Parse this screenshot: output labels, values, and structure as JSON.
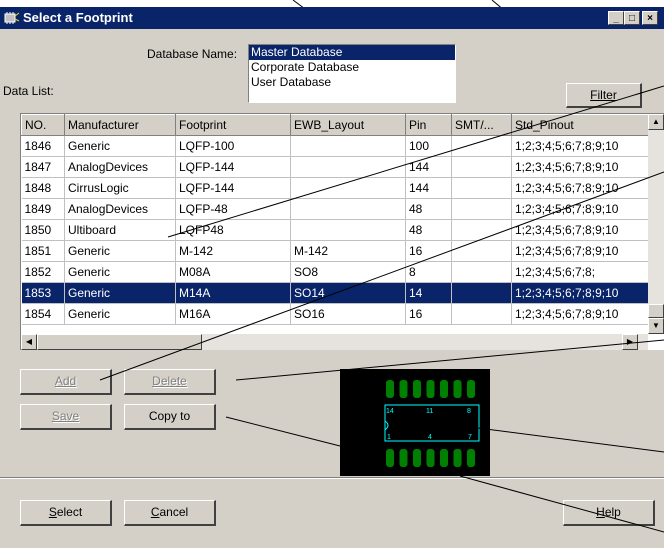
{
  "window": {
    "title": "Select a Footprint",
    "minimize_glyph": "_",
    "maximize_glyph": "□",
    "close_glyph": "×"
  },
  "database": {
    "label": "Database Name:",
    "options": [
      "Master Database",
      "Corporate Database",
      "User Database"
    ],
    "selected": "Master Database"
  },
  "data_list_label": "Data List:",
  "filter_button": "Filter",
  "table": {
    "columns": [
      "NO.",
      "Manufacturer",
      "Footprint",
      "EWB_Layout",
      "Pin",
      "SMT/...",
      "Std_Pinout"
    ],
    "rows": [
      [
        "1846",
        "Generic",
        "LQFP-100",
        "",
        "100",
        "",
        "1;2;3;4;5;6;7;8;9;10"
      ],
      [
        "1847",
        "AnalogDevices",
        "LQFP-144",
        "",
        "144",
        "",
        "1;2;3;4;5;6;7;8;9;10"
      ],
      [
        "1848",
        "CirrusLogic",
        "LQFP-144",
        "",
        "144",
        "",
        "1;2;3;4;5;6;7;8;9;10"
      ],
      [
        "1849",
        "AnalogDevices",
        "LQFP-48",
        "",
        "48",
        "",
        "1;2;3;4;5;6;7;8;9;10"
      ],
      [
        "1850",
        "Ultiboard",
        "LQFP48",
        "",
        "48",
        "",
        "1;2;3;4;5;6;7;8;9;10"
      ],
      [
        "1851",
        "Generic",
        "M-142",
        "M-142",
        "16",
        "",
        "1;2;3;4;5;6;7;8;9;10"
      ],
      [
        "1852",
        "Generic",
        "M08A",
        "SO8",
        "8",
        "",
        "1;2;3;4;5;6;7;8;"
      ],
      [
        "1853",
        "Generic",
        "M14A",
        "SO14",
        "14",
        "",
        "1;2;3;4;5;6;7;8;9;10"
      ],
      [
        "1854",
        "Generic",
        "M16A",
        "SO16",
        "16",
        "",
        "1;2;3;4;5;6;7;8;9;10"
      ]
    ],
    "selected_row": "1853"
  },
  "buttons": {
    "add": "Add",
    "delete": "Delete",
    "save": "Save",
    "copy_to": "Copy to",
    "select": "Select",
    "cancel": "Cancel",
    "help": "Help"
  },
  "preview": {
    "pin_labels": [
      "14",
      "11",
      "8",
      "1",
      "4",
      "7"
    ],
    "pad_color": "#008000",
    "outline_color": "#00ffff"
  },
  "colors": {
    "selection": "#0a246a",
    "face": "#d4d0c8"
  }
}
